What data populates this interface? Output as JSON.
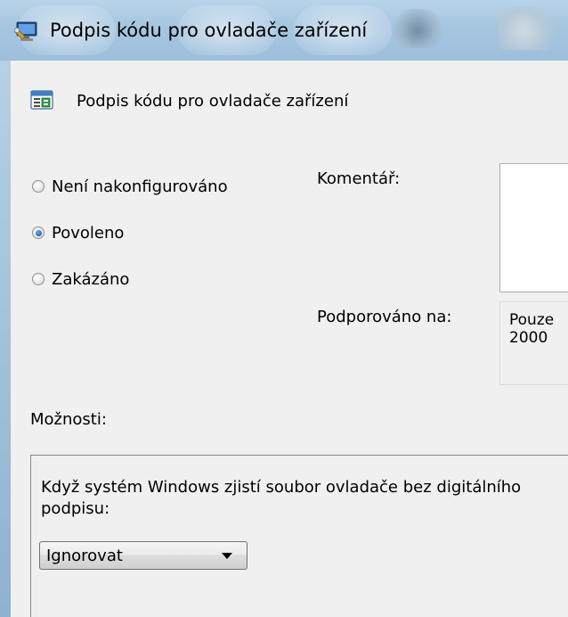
{
  "window": {
    "title": "Podpis kódu pro ovladače zařízení",
    "title_icon": "monitor-wrench-icon"
  },
  "header": {
    "title": "Podpis kódu pro ovladače zařízení",
    "icon": "policy-settings-icon"
  },
  "state": {
    "options": [
      {
        "label": "Není nakonfigurováno",
        "checked": false
      },
      {
        "label": "Povoleno",
        "checked": true
      },
      {
        "label": "Zakázáno",
        "checked": false
      }
    ]
  },
  "comment": {
    "label": "Komentář:",
    "value": ""
  },
  "supported": {
    "label": "Podporováno na:",
    "value": "Pouze\n2000"
  },
  "options_section": {
    "label": "Možnosti:",
    "description": "Když systém Windows zjistí soubor ovladače bez digitálního podpisu:",
    "selected": "Ignorovat"
  }
}
